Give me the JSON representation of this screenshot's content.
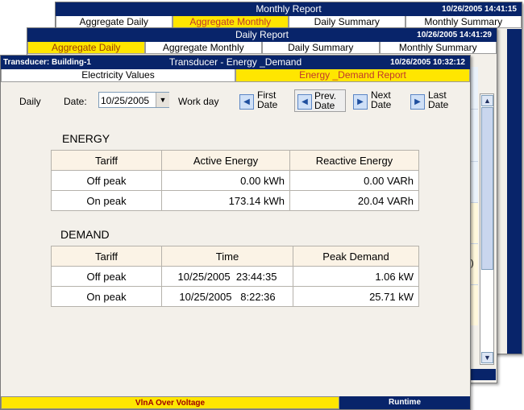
{
  "window_monthly": {
    "title": "Monthly Report",
    "datetime": "10/26/2005 14:41:15",
    "tabs": [
      {
        "label": "Aggregate Daily"
      },
      {
        "label": "Aggregate Monthly"
      },
      {
        "label": "Daily Summary"
      },
      {
        "label": "Monthly Summary"
      }
    ]
  },
  "window_daily": {
    "title": "Daily Report",
    "datetime": "10/26/2005 14:41:29",
    "tabs": [
      {
        "label": "Aggregate Daily"
      },
      {
        "label": "Aggregate Monthly"
      },
      {
        "label": "Daily Summary"
      },
      {
        "label": "Monthly Summary"
      }
    ],
    "side_text": ")"
  },
  "window_main": {
    "transducer": "Transducer: Building-1",
    "title": "Transducer - Energy _Demand",
    "datetime": "10/26/2005 10:32:12",
    "tabs": [
      {
        "label": "Electricity Values"
      },
      {
        "label": "Energy _Demand Report"
      }
    ],
    "toolbar": {
      "mode": "Daily",
      "date_label": "Date:",
      "date_value": "10/25/2005",
      "day_type": "Work day",
      "first": [
        "First",
        "Date"
      ],
      "prev": [
        "Prev.",
        "Date"
      ],
      "next": [
        "Next",
        "Date"
      ],
      "last": [
        "Last",
        "Date"
      ]
    },
    "energy": {
      "heading": "ENERGY",
      "columns": [
        "Tariff",
        "Active Energy",
        "Reactive Energy"
      ],
      "rows": [
        [
          "Off peak",
          "0.00 kWh",
          "0.00 VARh"
        ],
        [
          "On peak",
          "173.14 kWh",
          "20.04 VARh"
        ]
      ]
    },
    "demand": {
      "heading": "DEMAND",
      "columns": [
        "Tariff",
        "Time",
        "Peak Demand"
      ],
      "rows": [
        [
          "Off peak",
          "10/25/2005  23:44:35",
          "1.06 kW"
        ],
        [
          "On peak",
          "10/25/2005   8:22:36",
          "25.71 kW"
        ]
      ]
    },
    "status": {
      "alarm": "VlnA Over Voltage",
      "mode": "Runtime"
    }
  },
  "colors": {
    "titlebar": "#08246a",
    "active_tab": "#ffe600",
    "window_bg": "#f3f0ea"
  }
}
